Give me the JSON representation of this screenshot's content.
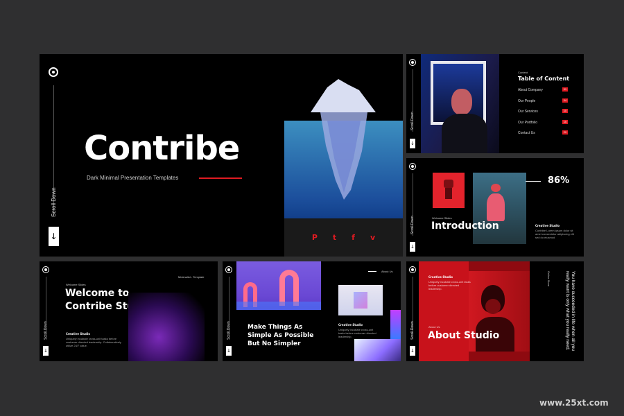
{
  "hero": {
    "title": "Contribe",
    "subtitle": "Dark Minimal Presentation Templates",
    "scroll": "Scroll Down",
    "arrow": "↓",
    "social": [
      "P",
      "t",
      "f",
      "v"
    ]
  },
  "toc": {
    "kicker": "Content",
    "title": "Table of Content",
    "scroll": "Scroll Down",
    "items": [
      {
        "label": "About Company",
        "num": "01"
      },
      {
        "label": "Our People",
        "num": "04"
      },
      {
        "label": "Our Services",
        "num": "10"
      },
      {
        "label": "Our Portfolio",
        "num": "15"
      },
      {
        "label": "Contact Us",
        "num": "20"
      }
    ]
  },
  "intro": {
    "percent": "86%",
    "kicker": "Welcome Slides",
    "title": "Introduction",
    "studio": "Creative Studio",
    "body": "Contribe Lorem ipsum dolor sit amet consectetur adipiscing elit sed do eiusmod",
    "scroll": "Scroll Down"
  },
  "welcome": {
    "kicker": "Welcome Slides",
    "title1": "Welcome to",
    "title2": "Contribe Studio",
    "top_right": "Minimalist - Template",
    "studio": "Creative Studio",
    "body": "Uniquely incubate cross-unit tasks before customer directed leadership. Collaboratively utilize 24/7 value.",
    "scroll": "Scroll Down"
  },
  "make": {
    "top_right": "About Us",
    "line1": "Make Things As",
    "line2": "Simple As Possible",
    "line3": "But No Simpler",
    "studio": "Creative Studio",
    "body": "Uniquely incubate cross-unit tasks before customer directed leadership.",
    "scroll": "Scroll Down"
  },
  "about": {
    "studio": "Creative Studio",
    "body": "Uniquely incubate cross-unit tasks before customer directed leadership.",
    "kicker": "About Us",
    "title": "About Studio",
    "quote": "You have succeeded in life when all you really want is only what you really need.",
    "side": "Online Store",
    "scroll": "Scroll Down"
  },
  "watermark": "www.25xt.com",
  "colors": {
    "accent": "#e01b22",
    "bg": "#2f2f30"
  }
}
